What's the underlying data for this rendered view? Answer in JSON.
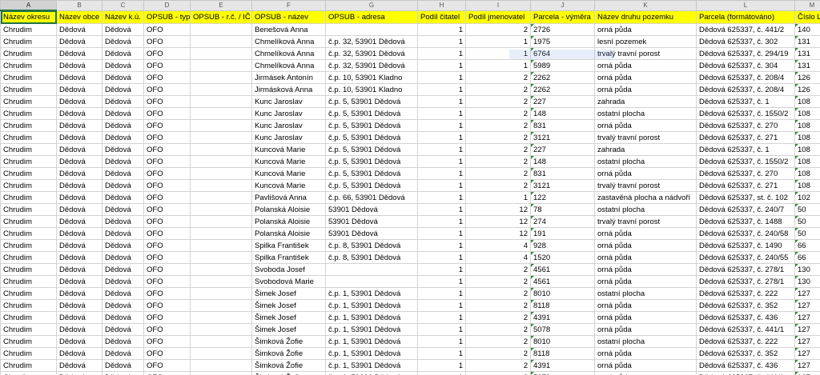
{
  "columns": [
    "A",
    "B",
    "C",
    "D",
    "E",
    "F",
    "G",
    "H",
    "I",
    "J",
    "K",
    "L",
    "M"
  ],
  "headers": [
    "Název okresu",
    "Název obce",
    "Název k.ú.",
    "OPSUB - typ",
    "OPSUB - r.č. / IČ",
    "OPSUB - název",
    "OPSUB  - adresa",
    "Podíl čitatel",
    "Podíl jmenovatel",
    "Parcela - výměra",
    "Název druhu pozemku",
    "Parcela (formátováno)",
    "Číslo LV"
  ],
  "rows": [
    [
      "Chrudim",
      "Dědová",
      "Dědová",
      "OFO",
      "",
      "Benešová Anna",
      "",
      "1",
      "2",
      "2726",
      "orná půda",
      "Dědová 625337, č. 441/2",
      "140"
    ],
    [
      "Chrudim",
      "Dědová",
      "Dědová",
      "OFO",
      "",
      "Chmelíková Anna",
      "č.p. 32, 53901 Dědová",
      "1",
      "1",
      "1975",
      "lesní pozemek",
      "Dědová 625337, č. 302",
      "131"
    ],
    [
      "Chrudim",
      "Dědová",
      "Dědová",
      "OFO",
      "",
      "Chmelíková Anna",
      "č.p. 32, 53901 Dědová",
      "1",
      "1",
      "6764",
      "trvalý travní porost",
      "Dědová 625337, č. 294/19",
      "131"
    ],
    [
      "Chrudim",
      "Dědová",
      "Dědová",
      "OFO",
      "",
      "Chmelíková Anna",
      "č.p. 32, 53901 Dědová",
      "1",
      "1",
      "5989",
      "orná půda",
      "Dědová 625337, č. 304",
      "131"
    ],
    [
      "Chrudim",
      "Dědová",
      "Dědová",
      "OFO",
      "",
      "Jirmásek Antonín",
      "č.p. 10, 53901 Kladno",
      "1",
      "2",
      "2262",
      "orná půda",
      "Dědová 625337, č. 208/4",
      "126"
    ],
    [
      "Chrudim",
      "Dědová",
      "Dědová",
      "OFO",
      "",
      "Jirmásková Anna",
      "č.p. 10, 53901 Kladno",
      "1",
      "2",
      "2262",
      "orná půda",
      "Dědová 625337, č. 208/4",
      "126"
    ],
    [
      "Chrudim",
      "Dědová",
      "Dědová",
      "OFO",
      "",
      "Kunc Jaroslav",
      "č.p. 5, 53901 Dědová",
      "1",
      "2",
      "227",
      "zahrada",
      "Dědová 625337, č. 1",
      "108"
    ],
    [
      "Chrudim",
      "Dědová",
      "Dědová",
      "OFO",
      "",
      "Kunc Jaroslav",
      "č.p. 5, 53901 Dědová",
      "1",
      "2",
      "148",
      "ostatní plocha",
      "Dědová 625337, č. 1550/2",
      "108"
    ],
    [
      "Chrudim",
      "Dědová",
      "Dědová",
      "OFO",
      "",
      "Kunc Jaroslav",
      "č.p. 5, 53901 Dědová",
      "1",
      "2",
      "831",
      "orná půda",
      "Dědová 625337, č. 270",
      "108"
    ],
    [
      "Chrudim",
      "Dědová",
      "Dědová",
      "OFO",
      "",
      "Kunc Jaroslav",
      "č.p. 5, 53901 Dědová",
      "1",
      "2",
      "3121",
      "trvalý travní porost",
      "Dědová 625337, č. 271",
      "108"
    ],
    [
      "Chrudim",
      "Dědová",
      "Dědová",
      "OFO",
      "",
      "Kuncová Marie",
      "č.p. 5, 53901 Dědová",
      "1",
      "2",
      "227",
      "zahrada",
      "Dědová 625337, č. 1",
      "108"
    ],
    [
      "Chrudim",
      "Dědová",
      "Dědová",
      "OFO",
      "",
      "Kuncová Marie",
      "č.p. 5, 53901 Dědová",
      "1",
      "2",
      "148",
      "ostatní plocha",
      "Dědová 625337, č. 1550/2",
      "108"
    ],
    [
      "Chrudim",
      "Dědová",
      "Dědová",
      "OFO",
      "",
      "Kuncová Marie",
      "č.p. 5, 53901 Dědová",
      "1",
      "2",
      "831",
      "orná půda",
      "Dědová 625337, č. 270",
      "108"
    ],
    [
      "Chrudim",
      "Dědová",
      "Dědová",
      "OFO",
      "",
      "Kuncová Marie",
      "č.p. 5, 53901 Dědová",
      "1",
      "2",
      "3121",
      "trvalý travní porost",
      "Dědová 625337, č. 271",
      "108"
    ],
    [
      "Chrudim",
      "Dědová",
      "Dědová",
      "OFO",
      "",
      "Pavlišová Anna",
      "č.p. 66, 53901 Dědová",
      "1",
      "1",
      "122",
      "zastavěná plocha a nádvoří",
      "Dědová 625337, st. č. 102",
      "102"
    ],
    [
      "Chrudim",
      "Dědová",
      "Dědová",
      "OFO",
      "",
      "Polanská Aloisie",
      "53901 Dědová",
      "1",
      "12",
      "78",
      "ostatní plocha",
      "Dědová 625337, č. 240/7",
      "50"
    ],
    [
      "Chrudim",
      "Dědová",
      "Dědová",
      "OFO",
      "",
      "Polanská Aloisie",
      "53901 Dědová",
      "1",
      "12",
      "274",
      "trvalý travní porost",
      "Dědová 625337, č. 1488",
      "50"
    ],
    [
      "Chrudim",
      "Dědová",
      "Dědová",
      "OFO",
      "",
      "Polanská Aloisie",
      "53901 Dědová",
      "1",
      "12",
      "191",
      "orná půda",
      "Dědová 625337, č. 240/58",
      "50"
    ],
    [
      "Chrudim",
      "Dědová",
      "Dědová",
      "OFO",
      "",
      "Spilka František",
      "č.p. 8, 53901 Dědová",
      "1",
      "4",
      "928",
      "orná půda",
      "Dědová 625337, č. 1490",
      "66"
    ],
    [
      "Chrudim",
      "Dědová",
      "Dědová",
      "OFO",
      "",
      "Spilka František",
      "č.p. 8, 53901 Dědová",
      "1",
      "4",
      "1520",
      "orná půda",
      "Dědová 625337, č. 240/55",
      "66"
    ],
    [
      "Chrudim",
      "Dědová",
      "Dědová",
      "OFO",
      "",
      "Svoboda Josef",
      "",
      "1",
      "2",
      "4561",
      "orná půda",
      "Dědová 625337, č. 278/1",
      "130"
    ],
    [
      "Chrudim",
      "Dědová",
      "Dědová",
      "OFO",
      "",
      "Svobodová Marie",
      "",
      "1",
      "2",
      "4561",
      "orná půda",
      "Dědová 625337, č. 278/1",
      "130"
    ],
    [
      "Chrudim",
      "Dědová",
      "Dědová",
      "OFO",
      "",
      "Šimek Josef",
      "č.p. 1, 53901 Dědová",
      "1",
      "2",
      "8010",
      "ostatní plocha",
      "Dědová 625337, č. 222",
      "127"
    ],
    [
      "Chrudim",
      "Dědová",
      "Dědová",
      "OFO",
      "",
      "Šimek Josef",
      "č.p. 1, 53901 Dědová",
      "1",
      "2",
      "8118",
      "orná půda",
      "Dědová 625337, č. 352",
      "127"
    ],
    [
      "Chrudim",
      "Dědová",
      "Dědová",
      "OFO",
      "",
      "Šimek Josef",
      "č.p. 1, 53901 Dědová",
      "1",
      "2",
      "4391",
      "orná půda",
      "Dědová 625337, č. 436",
      "127"
    ],
    [
      "Chrudim",
      "Dědová",
      "Dědová",
      "OFO",
      "",
      "Šimek Josef",
      "č.p. 1, 53901 Dědová",
      "1",
      "2",
      "5078",
      "orná půda",
      "Dědová 625337, č. 441/1",
      "127"
    ],
    [
      "Chrudim",
      "Dědová",
      "Dědová",
      "OFO",
      "",
      "Šimková Žofie",
      "č.p. 1, 53901 Dědová",
      "1",
      "2",
      "8010",
      "ostatní plocha",
      "Dědová 625337, č. 222",
      "127"
    ],
    [
      "Chrudim",
      "Dědová",
      "Dědová",
      "OFO",
      "",
      "Šimková Žofie",
      "č.p. 1, 53901 Dědová",
      "1",
      "2",
      "8118",
      "orná půda",
      "Dědová 625337, č. 352",
      "127"
    ],
    [
      "Chrudim",
      "Dědová",
      "Dědová",
      "OFO",
      "",
      "Šimková Žofie",
      "č.p. 1, 53901 Dědová",
      "1",
      "2",
      "4391",
      "orná půda",
      "Dědová 625337, č. 436",
      "127"
    ],
    [
      "Chrudim",
      "Dědová",
      "Dědová",
      "OFO",
      "",
      "Šimková Žofie",
      "č.p. 1, 53901 Dědová",
      "1",
      "2",
      "5078",
      "orná půda",
      "Dědová 625337, č. 441/1",
      "127"
    ]
  ]
}
